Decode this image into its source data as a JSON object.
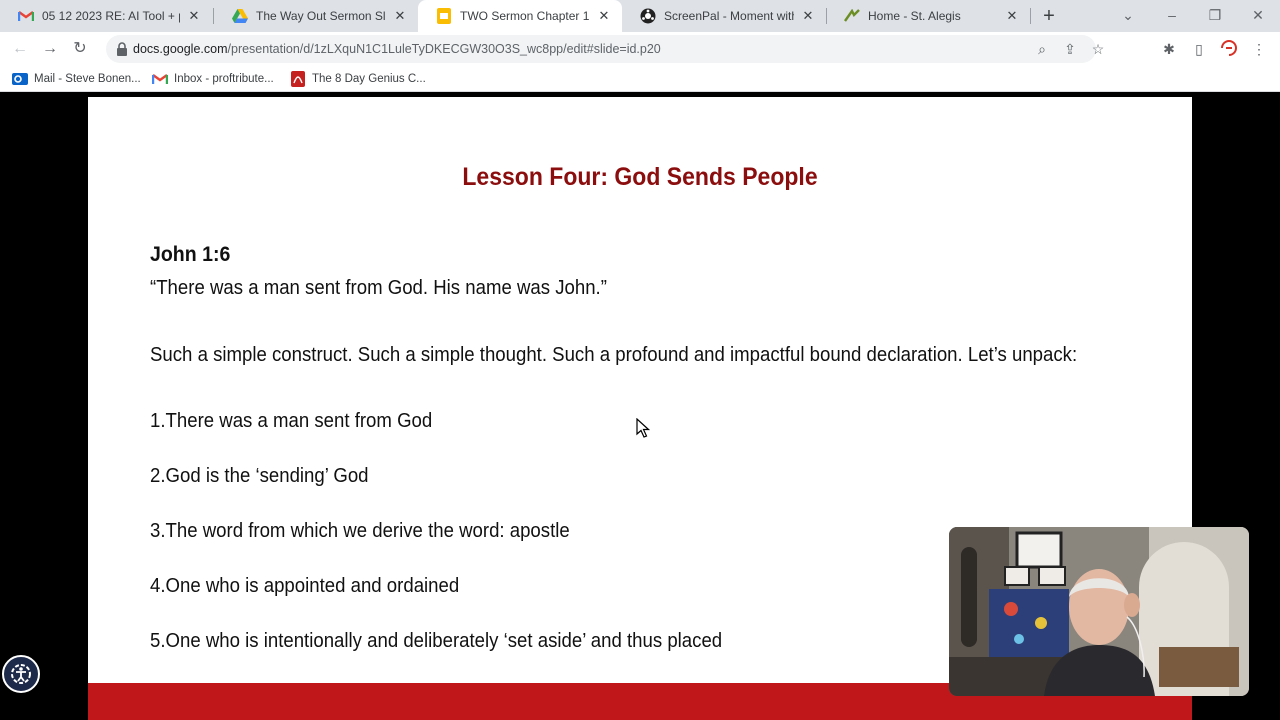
{
  "browser": {
    "tabs": [
      {
        "title": "05 12 2023 RE: AI Tool + prin",
        "favicon": "gmail-icon",
        "active": false
      },
      {
        "title": "The Way Out Sermon Slides",
        "favicon": "google-drive-icon",
        "active": false
      },
      {
        "title": "TWO Sermon Chapter 1.pptx",
        "favicon": "google-slides-icon",
        "active": true
      },
      {
        "title": "ScreenPal - Moment with Dr",
        "favicon": "screenpal-icon",
        "active": false
      },
      {
        "title": "Home - St. Alegis",
        "favicon": "site-icon",
        "active": false
      }
    ],
    "url_host": "docs.google.com",
    "url_path": "/presentation/d/1zLXquN1C1LuleTyDKECGW30O3S_wc8pp/edit#slide=id.p20",
    "bookmarks": [
      {
        "label": "Mail - Steve Bonen...",
        "icon": "outlook-icon"
      },
      {
        "label": "Inbox - proftribute...",
        "icon": "gmail-icon"
      },
      {
        "label": "The 8 Day Genius C...",
        "icon": "pdf-icon"
      }
    ]
  },
  "slide": {
    "title": "Lesson Four: God Sends People",
    "reference": "John 1:6",
    "quote": "“There was a man sent from God. His name was John.”",
    "intro": "Such a simple construct. Such a simple thought. Such a profound and impactful bound declaration. Let’s unpack:",
    "points": [
      "1.There was a man sent from God",
      "2.God is the ‘sending’ God",
      "3.The word from which we derive the word: apostle",
      "4.One who is appointed and ordained",
      "5.One who is intentionally and deliberately ‘set aside’ and thus placed"
    ],
    "title_color": "#8b0d0d",
    "footer_color": "#c0171b"
  }
}
